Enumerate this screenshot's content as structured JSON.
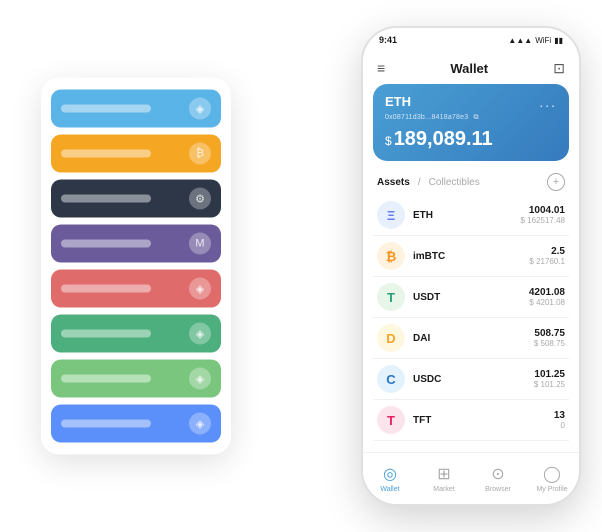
{
  "back_panel": {
    "cards": [
      {
        "color_class": "card-blue",
        "bar_text": "",
        "icon": "◈"
      },
      {
        "color_class": "card-orange",
        "bar_text": "",
        "icon": "₿"
      },
      {
        "color_class": "card-dark",
        "bar_text": "",
        "icon": "⚙"
      },
      {
        "color_class": "card-purple",
        "bar_text": "",
        "icon": "M"
      },
      {
        "color_class": "card-red",
        "bar_text": "",
        "icon": "◈"
      },
      {
        "color_class": "card-green",
        "bar_text": "",
        "icon": "◈"
      },
      {
        "color_class": "card-lightgreen",
        "bar_text": "",
        "icon": "◈"
      },
      {
        "color_class": "card-cornblue",
        "bar_text": "",
        "icon": "◈"
      }
    ]
  },
  "phone": {
    "status_bar": {
      "time": "9:41",
      "icons": "▲▲▲ ▼ ▮▮▮"
    },
    "header": {
      "menu_icon": "≡",
      "title": "Wallet",
      "scan_icon": "⊡"
    },
    "hero_card": {
      "coin": "ETH",
      "address": "0x08711d3b...8418a78e3",
      "copy_icon": "⧉",
      "more_icon": "...",
      "amount_symbol": "$",
      "amount": "189,089.11"
    },
    "assets_header": {
      "tab_active": "Assets",
      "separator": "/",
      "tab_inactive": "Collectibles",
      "add_icon": "+"
    },
    "assets": [
      {
        "icon_class": "icon-eth",
        "icon_text": "Ξ",
        "name": "ETH",
        "primary": "1004.01",
        "secondary": "$ 162517.48"
      },
      {
        "icon_class": "icon-imbtc",
        "icon_text": "₿",
        "name": "imBTC",
        "primary": "2.5",
        "secondary": "$ 21760.1"
      },
      {
        "icon_class": "icon-usdt",
        "icon_text": "T",
        "name": "USDT",
        "primary": "4201.08",
        "secondary": "$ 4201.08"
      },
      {
        "icon_class": "icon-dai",
        "icon_text": "D",
        "name": "DAI",
        "primary": "508.75",
        "secondary": "$ 508.75"
      },
      {
        "icon_class": "icon-usdc",
        "icon_text": "C",
        "name": "USDC",
        "primary": "101.25",
        "secondary": "$ 101.25"
      },
      {
        "icon_class": "icon-tft",
        "icon_text": "T",
        "name": "TFT",
        "primary": "13",
        "secondary": "0"
      }
    ],
    "bottom_nav": [
      {
        "icon": "◎",
        "label": "Wallet",
        "active": true
      },
      {
        "icon": "⊞",
        "label": "Market",
        "active": false
      },
      {
        "icon": "⊙",
        "label": "Browser",
        "active": false
      },
      {
        "icon": "◯",
        "label": "My Profile",
        "active": false
      }
    ]
  }
}
